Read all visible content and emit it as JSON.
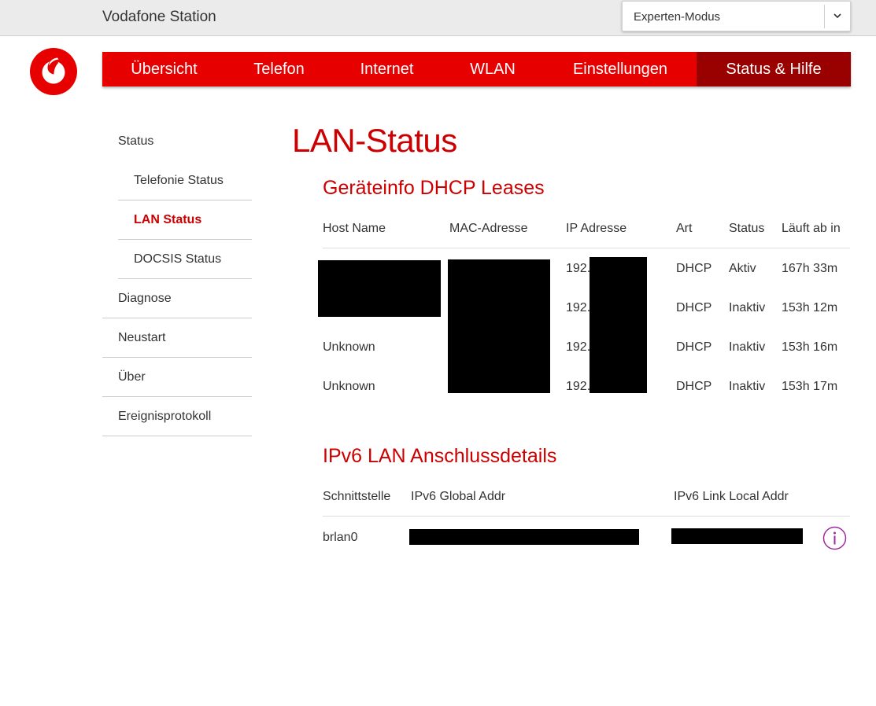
{
  "header": {
    "app_title": "Vodafone Station",
    "mode_select": {
      "value": "Experten-Modus"
    }
  },
  "nav": {
    "items": [
      {
        "label": "Übersicht"
      },
      {
        "label": "Telefon"
      },
      {
        "label": "Internet"
      },
      {
        "label": "WLAN"
      },
      {
        "label": "Einstellungen"
      },
      {
        "label": "Status & Hilfe",
        "active": true
      }
    ]
  },
  "sidebar": {
    "items": [
      {
        "label": "Status"
      },
      {
        "label": "Telefonie Status"
      },
      {
        "label": "LAN Status",
        "current": true
      },
      {
        "label": "DOCSIS Status"
      },
      {
        "label": "Diagnose"
      },
      {
        "label": "Neustart"
      },
      {
        "label": "Über"
      },
      {
        "label": "Ereignisprotokoll"
      }
    ]
  },
  "main": {
    "page_title": "LAN-Status",
    "dhcp": {
      "title": "Geräteinfo DHCP Leases",
      "columns": [
        "Host Name",
        "MAC-Adresse",
        "IP Adresse",
        "Art",
        "Status",
        "Läuft ab in"
      ],
      "rows": [
        {
          "host": "",
          "ip": "192.",
          "art": "DHCP",
          "status": "Aktiv",
          "expires": "167h 33m"
        },
        {
          "host": "",
          "ip": "192.",
          "art": "DHCP",
          "status": "Inaktiv",
          "expires": "153h 12m"
        },
        {
          "host": "Unknown",
          "ip": "192.",
          "art": "DHCP",
          "status": "Inaktiv",
          "expires": "153h 16m"
        },
        {
          "host": "Unknown",
          "ip": "192.",
          "art": "DHCP",
          "status": "Inaktiv",
          "expires": "153h 17m"
        }
      ]
    },
    "ipv6": {
      "title": "IPv6 LAN Anschlussdetails",
      "columns": [
        "Schnittstelle",
        "IPv6 Global Addr",
        "IPv6 Link Local Addr"
      ],
      "rows": [
        {
          "interface": "brlan0"
        }
      ]
    }
  },
  "colors": {
    "brand_red": "#e60000",
    "active_tab": "#990000",
    "title_red": "#cc0000",
    "info_icon": "#9c2aa0"
  },
  "icons": {
    "logo": "vodafone-logo",
    "select_chevron": "chevron-down-icon",
    "info": "info-icon"
  }
}
